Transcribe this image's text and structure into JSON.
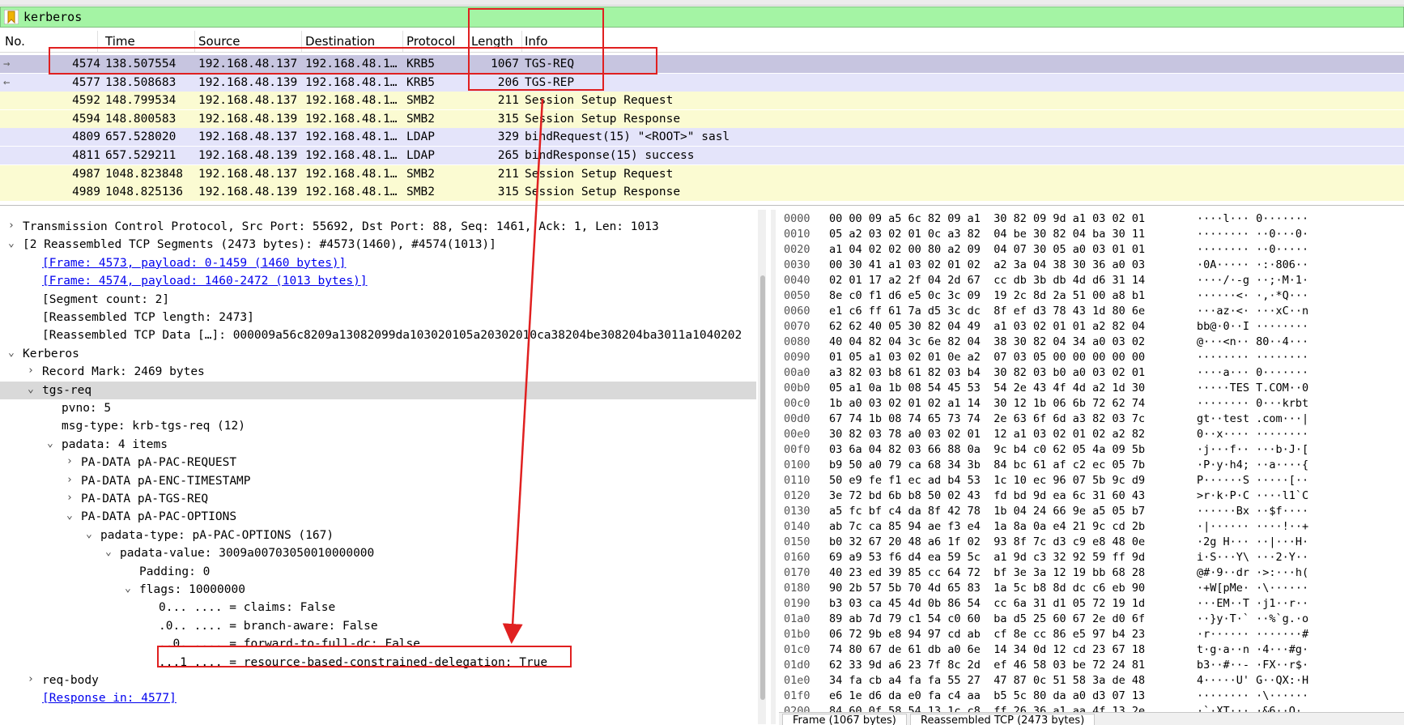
{
  "filter": {
    "text": "kerberos"
  },
  "columns": {
    "no": "No.",
    "time": "Time",
    "source": "Source",
    "destination": "Destination",
    "protocol": "Protocol",
    "length": "Length",
    "info": "Info"
  },
  "packets": [
    {
      "no": "4574",
      "time": "138.507554",
      "src": "192.168.48.137",
      "dst": "192.168.48.1…",
      "proto": "KRB5",
      "len": "1067",
      "info": "TGS-REQ",
      "color": "#c7c5e0",
      "arrow": "→"
    },
    {
      "no": "4577",
      "time": "138.508683",
      "src": "192.168.48.139",
      "dst": "192.168.48.1…",
      "proto": "KRB5",
      "len": "206",
      "info": "TGS-REP",
      "color": "#e4e4fa",
      "arrow": "←"
    },
    {
      "no": "4592",
      "time": "148.799534",
      "src": "192.168.48.137",
      "dst": "192.168.48.1…",
      "proto": "SMB2",
      "len": "211",
      "info": "Session Setup Request",
      "color": "#fbfbd2",
      "arrow": ""
    },
    {
      "no": "4594",
      "time": "148.800583",
      "src": "192.168.48.139",
      "dst": "192.168.48.1…",
      "proto": "SMB2",
      "len": "315",
      "info": "Session Setup Response",
      "color": "#fbfbd2",
      "arrow": ""
    },
    {
      "no": "4809",
      "time": "657.528020",
      "src": "192.168.48.137",
      "dst": "192.168.48.1…",
      "proto": "LDAP",
      "len": "329",
      "info": "bindRequest(15) \"<ROOT>\" sasl",
      "color": "#e4e4fa",
      "arrow": ""
    },
    {
      "no": "4811",
      "time": "657.529211",
      "src": "192.168.48.139",
      "dst": "192.168.48.1…",
      "proto": "LDAP",
      "len": "265",
      "info": "bindResponse(15) success",
      "color": "#e4e4fa",
      "arrow": ""
    },
    {
      "no": "4987",
      "time": "1048.823848",
      "src": "192.168.48.137",
      "dst": "192.168.48.1…",
      "proto": "SMB2",
      "len": "211",
      "info": "Session Setup Request",
      "color": "#fbfbd2",
      "arrow": ""
    },
    {
      "no": "4989",
      "time": "1048.825136",
      "src": "192.168.48.139",
      "dst": "192.168.48.1…",
      "proto": "SMB2",
      "len": "315",
      "info": "Session Setup Response",
      "color": "#fbfbd2",
      "arrow": ""
    }
  ],
  "tree": [
    {
      "exp": "›",
      "text": "Transmission Control Protocol, Src Port: 55692, Dst Port: 88, Seq: 1461, Ack: 1, Len: 1013",
      "level": 0
    },
    {
      "exp": "⌄",
      "text": "[2 Reassembled TCP Segments (2473 bytes): #4573(1460), #4574(1013)]",
      "level": 0
    },
    {
      "exp": "",
      "text": "[Frame: 4573, payload: 0-1459 (1460 bytes)]",
      "level": 1,
      "link": true
    },
    {
      "exp": "",
      "text": "[Frame: 4574, payload: 1460-2472 (1013 bytes)]",
      "level": 1,
      "link": true
    },
    {
      "exp": "",
      "text": "[Segment count: 2]",
      "level": 1
    },
    {
      "exp": "",
      "text": "[Reassembled TCP length: 2473]",
      "level": 1
    },
    {
      "exp": "",
      "text": "[Reassembled TCP Data […]: 000009a56c8209a13082099da103020105a20302010ca38204be308204ba3011a1040202",
      "level": 1
    },
    {
      "exp": "⌄",
      "text": "Kerberos",
      "level": 0
    },
    {
      "exp": "›",
      "text": "Record Mark: 2469 bytes",
      "level": 1
    },
    {
      "exp": "⌄",
      "text": "tgs-req",
      "level": 1
    },
    {
      "exp": "",
      "text": "pvno: 5",
      "level": 2
    },
    {
      "exp": "",
      "text": "msg-type: krb-tgs-req (12)",
      "level": 2
    },
    {
      "exp": "⌄",
      "text": "padata: 4 items",
      "level": 2
    },
    {
      "exp": "›",
      "text": "PA-DATA pA-PAC-REQUEST",
      "level": 3
    },
    {
      "exp": "›",
      "text": "PA-DATA pA-ENC-TIMESTAMP",
      "level": 3
    },
    {
      "exp": "›",
      "text": "PA-DATA pA-TGS-REQ",
      "level": 3
    },
    {
      "exp": "⌄",
      "text": "PA-DATA pA-PAC-OPTIONS",
      "level": 3
    },
    {
      "exp": "⌄",
      "text": "padata-type: pA-PAC-OPTIONS (167)",
      "level": 4
    },
    {
      "exp": "⌄",
      "text": "padata-value: 3009a00703050010000000",
      "level": 5
    },
    {
      "exp": "",
      "text": "Padding: 0",
      "level": 6
    },
    {
      "exp": "⌄",
      "text": "flags: 10000000",
      "level": 6
    },
    {
      "exp": "",
      "text": "0... .... = claims: False",
      "level": 7
    },
    {
      "exp": "",
      "text": ".0.. .... = branch-aware: False",
      "level": 7
    },
    {
      "exp": "",
      "text": "..0. .... = forward-to-full-dc: False",
      "level": 7
    },
    {
      "exp": "",
      "text": "...1 .... = resource-based-constrained-delegation: True",
      "level": 7
    },
    {
      "exp": "›",
      "text": "req-body",
      "level": 1
    },
    {
      "exp": "",
      "text": "[Response in: 4577]",
      "level": 1,
      "link": true
    }
  ],
  "hex": [
    {
      "off": "0000",
      "bytes": "00 00 09 a5 6c 82 09 a1  30 82 09 9d a1 03 02 01",
      "ascii": "····l··· 0·······"
    },
    {
      "off": "0010",
      "bytes": "05 a2 03 02 01 0c a3 82  04 be 30 82 04 ba 30 11",
      "ascii": "········ ··0···0·"
    },
    {
      "off": "0020",
      "bytes": "a1 04 02 02 00 80 a2 09  04 07 30 05 a0 03 01 01",
      "ascii": "········ ··0·····"
    },
    {
      "off": "0030",
      "bytes": "00 30 41 a1 03 02 01 02  a2 3a 04 38 30 36 a0 03",
      "ascii": "·0A····· ·:·806··"
    },
    {
      "off": "0040",
      "bytes": "02 01 17 a2 2f 04 2d 67  cc db 3b db 4d d6 31 14",
      "ascii": "····/·-g ··;·M·1·"
    },
    {
      "off": "0050",
      "bytes": "8e c0 f1 d6 e5 0c 3c 09  19 2c 8d 2a 51 00 a8 b1",
      "ascii": "······<· ·,·*Q···"
    },
    {
      "off": "0060",
      "bytes": "e1 c6 ff 61 7a d5 3c dc  8f ef d3 78 43 1d 80 6e",
      "ascii": "···az·<· ···xC··n"
    },
    {
      "off": "0070",
      "bytes": "62 62 40 05 30 82 04 49  a1 03 02 01 01 a2 82 04",
      "ascii": "bb@·0··I ········"
    },
    {
      "off": "0080",
      "bytes": "40 04 82 04 3c 6e 82 04  38 30 82 04 34 a0 03 02",
      "ascii": "@···<n·· 80··4···"
    },
    {
      "off": "0090",
      "bytes": "01 05 a1 03 02 01 0e a2  07 03 05 00 00 00 00 00",
      "ascii": "········ ········"
    },
    {
      "off": "00a0",
      "bytes": "a3 82 03 b8 61 82 03 b4  30 82 03 b0 a0 03 02 01",
      "ascii": "····a··· 0·······"
    },
    {
      "off": "00b0",
      "bytes": "05 a1 0a 1b 08 54 45 53  54 2e 43 4f 4d a2 1d 30",
      "ascii": "·····TES T.COM··0"
    },
    {
      "off": "00c0",
      "bytes": "1b a0 03 02 01 02 a1 14  30 12 1b 06 6b 72 62 74",
      "ascii": "········ 0···krbt"
    },
    {
      "off": "00d0",
      "bytes": "67 74 1b 08 74 65 73 74  2e 63 6f 6d a3 82 03 7c",
      "ascii": "gt··test .com···|"
    },
    {
      "off": "00e0",
      "bytes": "30 82 03 78 a0 03 02 01  12 a1 03 02 01 02 a2 82",
      "ascii": "0··x···· ········"
    },
    {
      "off": "00f0",
      "bytes": "03 6a 04 82 03 66 88 0a  9c b4 c0 62 05 4a 09 5b",
      "ascii": "·j···f·· ···b·J·["
    },
    {
      "off": "0100",
      "bytes": "b9 50 a0 79 ca 68 34 3b  84 bc 61 af c2 ec 05 7b",
      "ascii": "·P·y·h4; ··a····{"
    },
    {
      "off": "0110",
      "bytes": "50 e9 fe f1 ec ad b4 53  1c 10 ec 96 07 5b 9c d9",
      "ascii": "P······S ·····[··"
    },
    {
      "off": "0120",
      "bytes": "3e 72 bd 6b b8 50 02 43  fd bd 9d ea 6c 31 60 43",
      "ascii": ">r·k·P·C ····l1`C"
    },
    {
      "off": "0130",
      "bytes": "a5 fc bf c4 da 8f 42 78  1b 04 24 66 9e a5 05 b7",
      "ascii": "······Bx ··$f····"
    },
    {
      "off": "0140",
      "bytes": "ab 7c ca 85 94 ae f3 e4  1a 8a 0a e4 21 9c cd 2b",
      "ascii": "·|······ ····!··+"
    },
    {
      "off": "0150",
      "bytes": "b0 32 67 20 48 a6 1f 02  93 8f 7c d3 c9 e8 48 0e",
      "ascii": "·2g H··· ··|···H·"
    },
    {
      "off": "0160",
      "bytes": "69 a9 53 f6 d4 ea 59 5c  a1 9d c3 32 92 59 ff 9d",
      "ascii": "i·S···Y\\ ···2·Y··"
    },
    {
      "off": "0170",
      "bytes": "40 23 ed 39 85 cc 64 72  bf 3e 3a 12 19 bb 68 28",
      "ascii": "@#·9··dr ·>:···h("
    },
    {
      "off": "0180",
      "bytes": "90 2b 57 5b 70 4d 65 83  1a 5c b8 8d dc c6 eb 90",
      "ascii": "·+W[pMe· ·\\······"
    },
    {
      "off": "0190",
      "bytes": "b3 03 ca 45 4d 0b 86 54  cc 6a 31 d1 05 72 19 1d",
      "ascii": "···EM··T ·j1··r··"
    },
    {
      "off": "01a0",
      "bytes": "89 ab 7d 79 c1 54 c0 60  ba d5 25 60 67 2e d0 6f",
      "ascii": "··}y·T·` ··%`g.·o"
    },
    {
      "off": "01b0",
      "bytes": "06 72 9b e8 94 97 cd ab  cf 8e cc 86 e5 97 b4 23",
      "ascii": "·r······ ·······#"
    },
    {
      "off": "01c0",
      "bytes": "74 80 67 de 61 db a0 6e  14 34 0d 12 cd 23 67 18",
      "ascii": "t·g·a··n ·4···#g·"
    },
    {
      "off": "01d0",
      "bytes": "62 33 9d a6 23 7f 8c 2d  ef 46 58 03 be 72 24 81",
      "ascii": "b3··#··- ·FX··r$·"
    },
    {
      "off": "01e0",
      "bytes": "34 fa cb a4 fa fa 55 27  47 87 0c 51 58 3a de 48",
      "ascii": "4·····U' G··QX:·H"
    },
    {
      "off": "01f0",
      "bytes": "e6 1e d6 da e0 fa c4 aa  b5 5c 80 da a0 d3 07 13",
      "ascii": "········ ·\\······"
    },
    {
      "off": "0200",
      "bytes": "84 60 0f 58 54 13 1c c8  ff 26 36 a1 aa 4f 13 2e",
      "ascii": "·`·XT··· ·&6··O·."
    }
  ],
  "bottom_tabs": [
    "Frame (1067 bytes)",
    "Reassembled TCP (2473 bytes)"
  ],
  "colors": {
    "filter_bg": "#a4f4a4",
    "annotation": "#e02020",
    "link": "#0000ee"
  }
}
